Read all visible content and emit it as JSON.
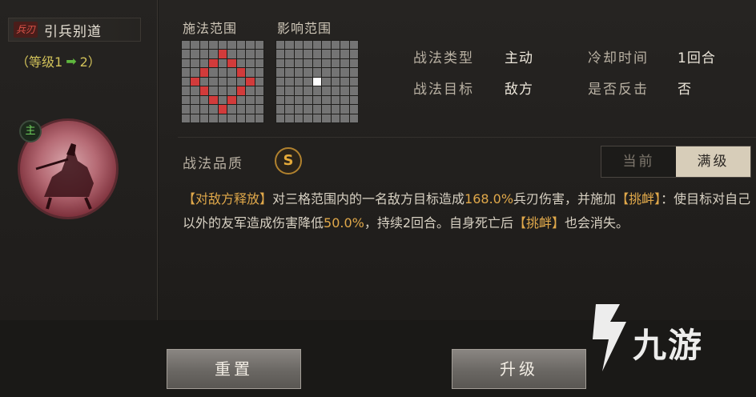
{
  "tactic": {
    "type_badge": "兵刃",
    "name": "引兵别道",
    "level_open": "（等级1",
    "level_arrow": "➡",
    "level_close": "2）",
    "portrait_badge": "主"
  },
  "ranges": {
    "cast_label": "施法范围",
    "effect_label": "影响范围",
    "cast_grid": [
      "000000000",
      "000010000",
      "000101000",
      "001000100",
      "010000010",
      "001000100",
      "000101000",
      "000010000",
      "000000000"
    ],
    "effect_grid": [
      "000000000",
      "000000000",
      "000000000",
      "000000000",
      "000020000",
      "000000000",
      "000000000",
      "000000000",
      "000000000"
    ]
  },
  "info": {
    "type_label": "战法类型",
    "type_value": "主动",
    "cooldown_label": "冷却时间",
    "cooldown_value": "1回合",
    "target_label": "战法目标",
    "target_value": "敌方",
    "counter_label": "是否反击",
    "counter_value": "否"
  },
  "quality": {
    "label": "战法品质",
    "grade": "S"
  },
  "toggle": {
    "current": "当前",
    "max": "满级"
  },
  "description": {
    "tag1": "【对敌方释放】",
    "t1": "对三格范围内的一名敌方目标造成",
    "dmg": "168.0%",
    "t2": "兵刃伤害，并施加",
    "tag2": "【挑衅】",
    "t3": "：使目标对自己以外的友军造成伤害降低",
    "reduce": "50.0%",
    "t4": "，持续2回合。自身死亡后",
    "tag3": "【挑衅】",
    "t5": "也会消失。"
  },
  "buttons": {
    "reset": "重置",
    "upgrade": "升级"
  },
  "watermark": {
    "text": "九游"
  },
  "colors": {
    "highlight": "#e0a84a",
    "cast_cell": "#d23b3b",
    "grid_cell": "#747474",
    "effect_cell": "#ffffff"
  }
}
